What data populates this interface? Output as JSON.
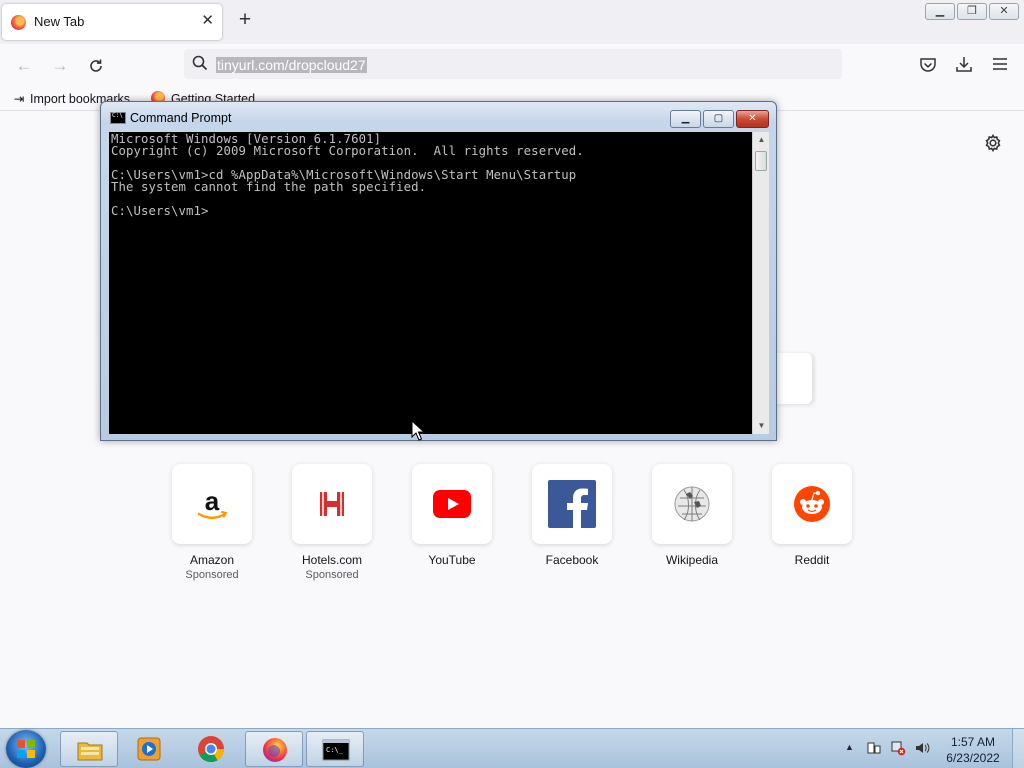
{
  "browser": {
    "tab": {
      "title": "New Tab"
    },
    "new_tab_symbol": "+",
    "address_bar": {
      "url": "tinyurl.com/dropcloud27"
    },
    "bookmarks": [
      {
        "label": "Import bookmarks...",
        "icon": "import-icon"
      },
      {
        "label": "Getting Started",
        "icon": "firefox-icon"
      }
    ]
  },
  "new_tab_page": {
    "shortcuts": [
      {
        "name": "Amazon",
        "sponsored_label": "Sponsored",
        "icon": "amazon-icon"
      },
      {
        "name": "Hotels.com",
        "sponsored_label": "Sponsored",
        "icon": "hotels-icon"
      },
      {
        "name": "YouTube",
        "sponsored_label": "",
        "icon": "youtube-icon"
      },
      {
        "name": "Facebook",
        "sponsored_label": "",
        "icon": "facebook-icon"
      },
      {
        "name": "Wikipedia",
        "sponsored_label": "",
        "icon": "wikipedia-icon"
      },
      {
        "name": "Reddit",
        "sponsored_label": "",
        "icon": "reddit-icon"
      }
    ]
  },
  "cmd_window": {
    "title": "Command Prompt",
    "lines": [
      "Microsoft Windows [Version 6.1.7601]",
      "Copyright (c) 2009 Microsoft Corporation.  All rights reserved.",
      "",
      "C:\\Users\\vm1>cd %AppData%\\Microsoft\\Windows\\Start Menu\\Startup",
      "The system cannot find the path specified.",
      "",
      "C:\\Users\\vm1>"
    ]
  },
  "taskbar": {
    "clock_time": "1:57 AM",
    "clock_date": "6/23/2022",
    "pinned": [
      "explorer-icon",
      "media-player-icon",
      "chrome-icon",
      "firefox-icon",
      "cmd-icon"
    ]
  },
  "colors": {
    "youtube_red": "#ff0000",
    "facebook_blue": "#3b5998",
    "reddit_orange": "#ff4500",
    "hotels_red": "#d32f2f",
    "amazon_orange": "#ff9900"
  }
}
